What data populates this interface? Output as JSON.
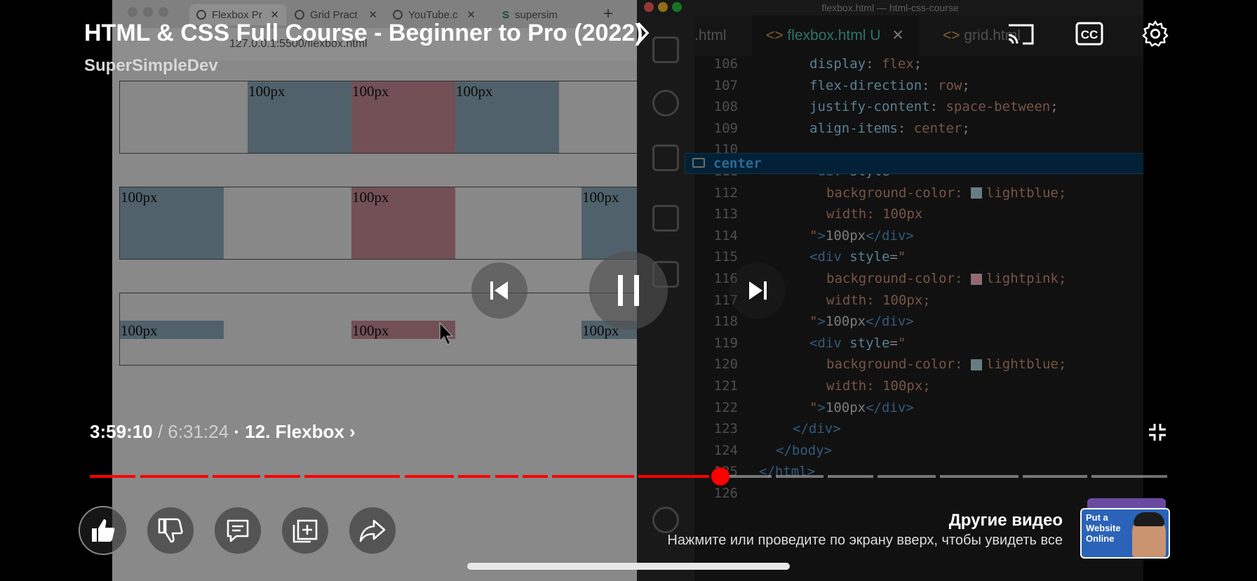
{
  "video": {
    "title": "HTML & CSS Full Course - Beginner to Pro (2022)",
    "channel": "SuperSimpleDev",
    "time_current": "3:59:10",
    "time_total": "/ 6:31:24",
    "chapter": "· 12. Flexbox",
    "chapter_chevron": "›",
    "progress_fraction": 0.585,
    "accent_color": "#ff0000"
  },
  "more_videos": {
    "title": "Другие видео",
    "hint": "Нажмите или проведите по экрану вверх, чтобы увидеть все",
    "thumbnail_text": "Put a Website Online"
  },
  "browser": {
    "tabs": [
      "Flexbox Pr",
      "Grid Pract",
      "YouTube.c",
      "supersim"
    ],
    "url": "127.0.0.1:5500/flexbox.html",
    "box_label": "100px"
  },
  "vscode": {
    "window_title": "flexbox.html — html-css-course",
    "tab_prev": ".html",
    "tab_active": "flexbox.html",
    "tab_active_badge": "U",
    "tab_next": "grid.html",
    "suggestion": "center",
    "lines": [
      {
        "n": "106",
        "parts": [
          [
            "prop",
            "display"
          ],
          [
            "plain",
            ": "
          ],
          [
            "val",
            "flex"
          ],
          [
            "plain",
            ";"
          ]
        ],
        "indent": 3
      },
      {
        "n": "107",
        "parts": [
          [
            "prop",
            "flex-direction"
          ],
          [
            "plain",
            ": "
          ],
          [
            "val",
            "row"
          ],
          [
            "plain",
            ";"
          ]
        ],
        "indent": 3
      },
      {
        "n": "108",
        "parts": [
          [
            "prop",
            "justify-content"
          ],
          [
            "plain",
            ": "
          ],
          [
            "val",
            "space-between"
          ],
          [
            "plain",
            ";"
          ]
        ],
        "indent": 3
      },
      {
        "n": "109",
        "parts": [
          [
            "prop",
            "align-items"
          ],
          [
            "plain",
            ": "
          ],
          [
            "val",
            "center"
          ],
          [
            "plain",
            ";"
          ]
        ],
        "indent": 3
      },
      {
        "n": "110",
        "parts": [],
        "indent": 3
      },
      {
        "n": "111",
        "parts": [
          [
            "tag",
            "<div "
          ],
          [
            "prop",
            "style"
          ],
          [
            "plain",
            "="
          ],
          [
            "val",
            "\""
          ]
        ],
        "indent": 3
      },
      {
        "n": "112",
        "parts": [
          [
            "val",
            "background-color: "
          ],
          [
            "swatch",
            "#add8e6"
          ],
          [
            "val",
            "lightblue;"
          ]
        ],
        "indent": 4
      },
      {
        "n": "113",
        "parts": [
          [
            "val",
            "width: 100px"
          ]
        ],
        "indent": 4
      },
      {
        "n": "114",
        "parts": [
          [
            "val",
            "\""
          ],
          [
            "tag",
            ">"
          ],
          [
            "plain",
            "100px"
          ],
          [
            "tag",
            "</div>"
          ]
        ],
        "indent": 3
      },
      {
        "n": "115",
        "parts": [
          [
            "tag",
            "<div "
          ],
          [
            "prop",
            "style"
          ],
          [
            "plain",
            "="
          ],
          [
            "val",
            "\""
          ]
        ],
        "indent": 3
      },
      {
        "n": "116",
        "parts": [
          [
            "val",
            "background-color: "
          ],
          [
            "swatch",
            "#ffb6c1"
          ],
          [
            "val",
            "lightpink;"
          ]
        ],
        "indent": 4
      },
      {
        "n": "117",
        "parts": [
          [
            "val",
            "width: 100px;"
          ]
        ],
        "indent": 4
      },
      {
        "n": "118",
        "parts": [
          [
            "val",
            "\""
          ],
          [
            "tag",
            ">"
          ],
          [
            "plain",
            "100px"
          ],
          [
            "tag",
            "</div>"
          ]
        ],
        "indent": 3
      },
      {
        "n": "119",
        "parts": [
          [
            "tag",
            "<div "
          ],
          [
            "prop",
            "style"
          ],
          [
            "plain",
            "="
          ],
          [
            "val",
            "\""
          ]
        ],
        "indent": 3
      },
      {
        "n": "120",
        "parts": [
          [
            "val",
            "background-color: "
          ],
          [
            "swatch",
            "#add8e6"
          ],
          [
            "val",
            "lightblue;"
          ]
        ],
        "indent": 4
      },
      {
        "n": "121",
        "parts": [
          [
            "val",
            "width: 100px;"
          ]
        ],
        "indent": 4
      },
      {
        "n": "122",
        "parts": [
          [
            "val",
            "\""
          ],
          [
            "tag",
            ">"
          ],
          [
            "plain",
            "100px"
          ],
          [
            "tag",
            "</div>"
          ]
        ],
        "indent": 3
      },
      {
        "n": "123",
        "parts": [
          [
            "tag",
            "</div>"
          ]
        ],
        "indent": 2
      },
      {
        "n": "124",
        "parts": [
          [
            "tag",
            "</body>"
          ]
        ],
        "indent": 1
      },
      {
        "n": "125",
        "parts": [
          [
            "tag",
            "</html>"
          ]
        ],
        "indent": 0
      },
      {
        "n": "126",
        "parts": [],
        "indent": 0
      }
    ]
  }
}
